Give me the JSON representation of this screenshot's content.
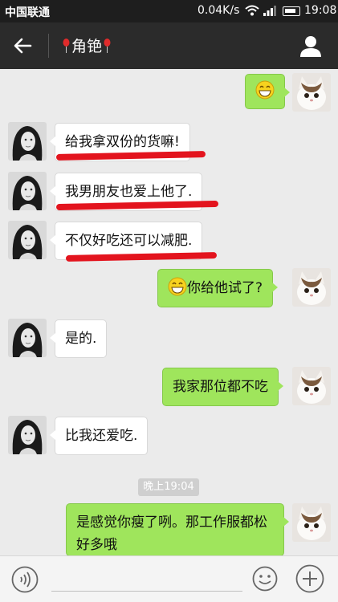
{
  "status_bar": {
    "carrier": "中国联通",
    "speed": "0.04K/s",
    "time": "19:08"
  },
  "header": {
    "title": "角铯"
  },
  "messages": [
    {
      "from": "me",
      "emoji": "grin-emoji"
    },
    {
      "from": "them",
      "text": "给我拿双份的货嘛!"
    },
    {
      "from": "them",
      "text": "我男朋友也爱上他了."
    },
    {
      "from": "them",
      "text": "不仅好吃还可以减肥."
    },
    {
      "from": "me",
      "text": "你给他试了?"
    },
    {
      "from": "them",
      "text": "是的."
    },
    {
      "from": "me",
      "text": "我家那位都不吃"
    },
    {
      "from": "them",
      "text": "比我还爱吃."
    },
    {
      "from": "me",
      "text": "是感觉你瘦了咧。那工作服都松好多哦"
    }
  ],
  "timestamp": "晚上19:04",
  "colors": {
    "out_bubble": "#9fe55c",
    "in_bubble": "#ffffff",
    "underline": "#e3141e",
    "titlebar": "#2b2b2b"
  }
}
